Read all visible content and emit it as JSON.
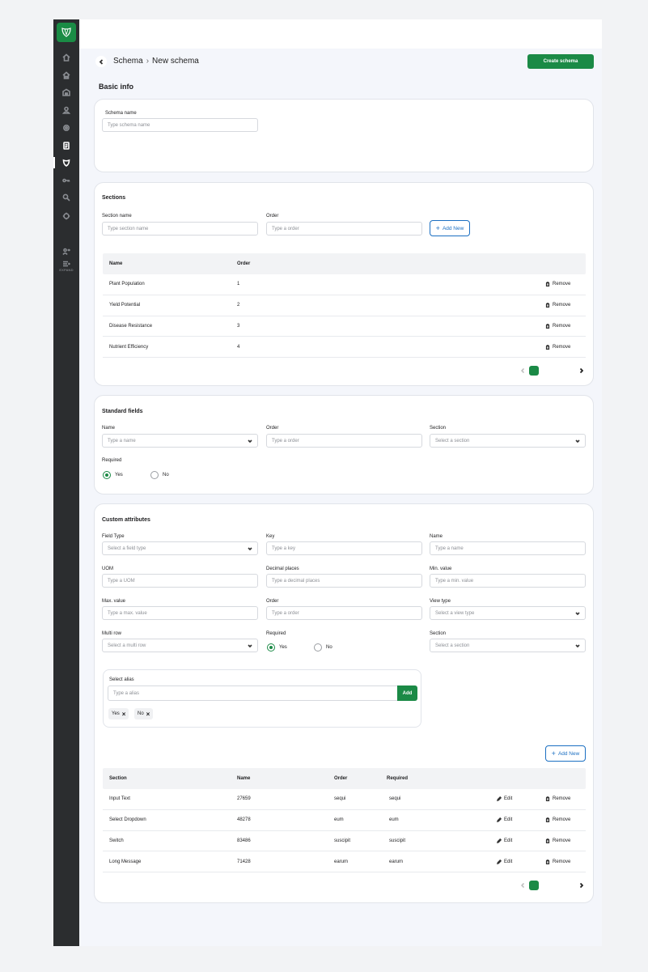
{
  "breadcrumb": {
    "parent": "Schema",
    "separator": "›",
    "current": "New schema"
  },
  "header": {
    "create_button": "Create schema"
  },
  "basic_info": {
    "title": "Basic info",
    "schema_name_label": "Schema name",
    "schema_name_placeholder": "Type schema name"
  },
  "sections": {
    "title": "Sections",
    "section_name_label": "Section name",
    "section_name_placeholder": "Type section name",
    "order_label": "Order",
    "order_placeholder": "Type a order",
    "add_button": "Add New",
    "columns": [
      "Name",
      "Order"
    ],
    "rows": [
      {
        "name": "Plant Population",
        "order": "1",
        "action": "Remove"
      },
      {
        "name": "Yield Potential",
        "order": "2",
        "action": "Remove"
      },
      {
        "name": "Disease Resistance",
        "order": "3",
        "action": "Remove"
      },
      {
        "name": "Nutrient Efficiency",
        "order": "4",
        "action": "Remove"
      }
    ],
    "current_page": "1"
  },
  "standard_fields": {
    "title": "Standard fields",
    "name_label": "Name",
    "name_placeholder": "Type a name",
    "order_label": "Order",
    "order_placeholder": "Type a order",
    "section_label": "Section",
    "section_placeholder": "Select a section",
    "required_label": "Required",
    "yes": "Yes",
    "no": "No"
  },
  "custom_attributes": {
    "title": "Custom attributes",
    "field_type_label": "Field Type",
    "field_type_placeholder": "Select a field type",
    "key_label": "Key",
    "key_placeholder": "Type a key",
    "name_label": "Name",
    "name_placeholder": "Type a name",
    "uom_label": "UOM",
    "uom_placeholder": "Type a UOM",
    "decimal_label": "Decimal places",
    "decimal_placeholder": "Type a decimal places",
    "min_label": "Min. value",
    "min_placeholder": "Type a min. value",
    "max_label": "Max. value",
    "max_placeholder": "Type a max. value",
    "order_label": "Order",
    "order_placeholder": "Type a order",
    "view_type_label": "View type",
    "view_type_placeholder": "Select a view type",
    "multi_row_label": "Multi row",
    "multi_row_placeholder": "Select a multi row",
    "required_label": "Required",
    "yes": "Yes",
    "no": "No",
    "section_label": "Section",
    "section_placeholder": "Select a section",
    "alias_label": "Select alias",
    "alias_placeholder": "Type a alias",
    "alias_add": "Add",
    "chips": [
      "Yes",
      "No"
    ],
    "add_button": "Add New",
    "columns": [
      "Section",
      "Name",
      "Order",
      "Required"
    ],
    "rows": [
      {
        "section": "Input Text",
        "name": "27659",
        "order": "sequi",
        "required": "sequi",
        "edit": "Edit",
        "remove": "Remove"
      },
      {
        "section": "Select Dropdown",
        "name": "48278",
        "order": "eum",
        "required": "eum",
        "edit": "Edit",
        "remove": "Remove"
      },
      {
        "section": "Switch",
        "name": "83486",
        "order": "suscipit",
        "required": "suscipit",
        "edit": "Edit",
        "remove": "Remove"
      },
      {
        "section": "Long Message",
        "name": "71428",
        "order": "earum",
        "required": "earum",
        "edit": "Edit",
        "remove": "Remove"
      }
    ],
    "current_page": "1"
  },
  "sidebar": {
    "expand_label": "EXPAND"
  },
  "colors": {
    "brand": "#1b8a46",
    "sidebar": "#2b2d2f",
    "link": "#1b6fc2"
  }
}
